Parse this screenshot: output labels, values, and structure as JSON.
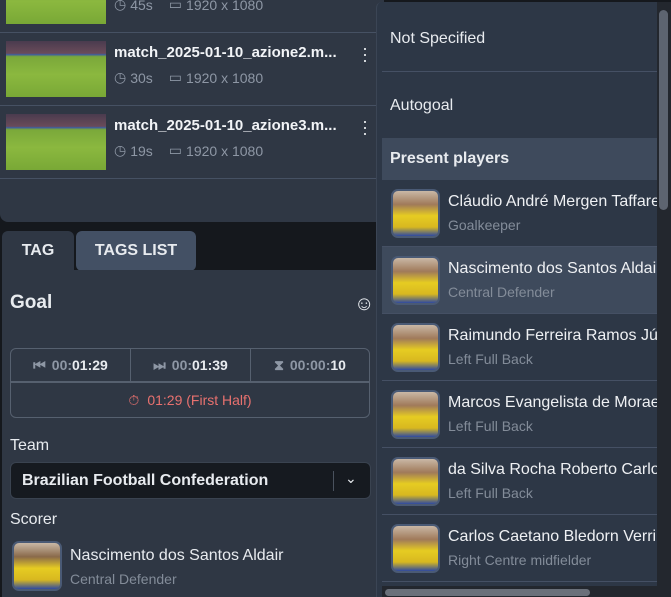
{
  "videos": [
    {
      "name": "",
      "duration": "45s",
      "resolution": "1920 x 1080"
    },
    {
      "name": "match_2025-01-10_azione2.m...",
      "duration": "30s",
      "resolution": "1920 x 1080"
    },
    {
      "name": "match_2025-01-10_azione3.m...",
      "duration": "19s",
      "resolution": "1920 x 1080"
    }
  ],
  "tabs": {
    "tag": "TAG",
    "tags_list": "TAGS LIST"
  },
  "tag": {
    "title": "Goal",
    "start_prefix": "00:",
    "start": "01:29",
    "end_prefix": "00:",
    "end": "01:39",
    "duration_prefix": "00:00:",
    "duration": "10",
    "event_time": "01:29 (First Half)",
    "team_label": "Team",
    "team_value": "Brazilian Football Confederation",
    "scorer_label": "Scorer",
    "scorer_name": "Nascimento dos Santos Aldair",
    "scorer_role": "Central Defender"
  },
  "dropdown": {
    "not_specified": "Not Specified",
    "autogoal": "Autogoal",
    "section": "Present players",
    "players": [
      {
        "name": "Cláudio André Mergen Taffarel",
        "role": "Goalkeeper"
      },
      {
        "name": "Nascimento dos Santos Aldair",
        "role": "Central Defender"
      },
      {
        "name": "Raimundo Ferreira Ramos Júnior",
        "role": "Left Full Back"
      },
      {
        "name": "Marcos Evangelista de Moraes",
        "role": "Left Full Back"
      },
      {
        "name": "da Silva Rocha Roberto Carlos",
        "role": "Left Full Back"
      },
      {
        "name": "Carlos Caetano Bledorn Verri",
        "role": "Right Centre midfielder"
      }
    ],
    "highlighted_index": 1
  },
  "colors": {
    "accent_red": "#e8716f",
    "panel": "#2f3744",
    "dropdown": "#2d3746",
    "highlight": "#3e4a5c"
  }
}
